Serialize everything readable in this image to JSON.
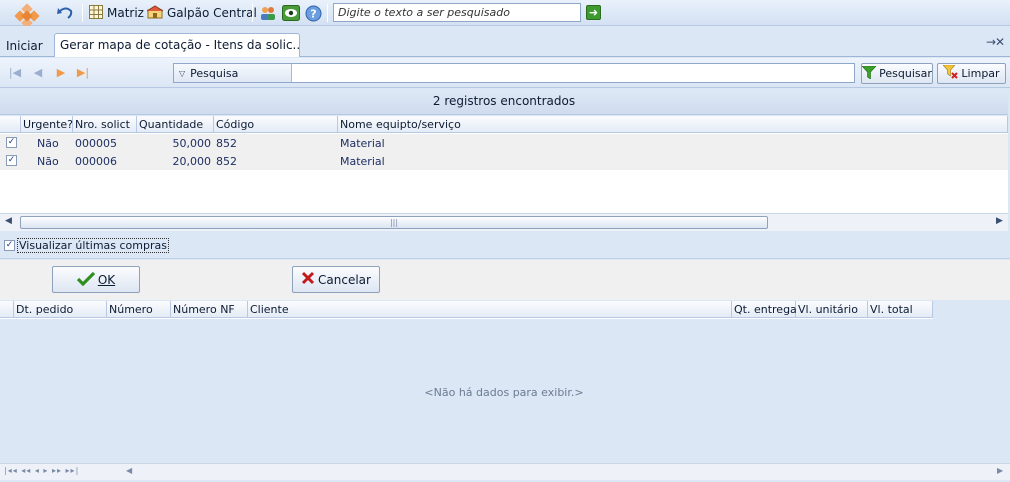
{
  "toolbar": {
    "items": [
      {
        "label": "Matriz",
        "icon": "grid-icon"
      },
      {
        "label": "Galpão Central",
        "icon": "warehouse-icon"
      }
    ],
    "search_placeholder": "Digite o texto a ser pesquisado"
  },
  "tabs": {
    "home": "Iniciar",
    "active": "Gerar mapa de cotação - Itens da solic..."
  },
  "filter": {
    "dropdown_label": "Pesquisa",
    "search_button": "Pesquisar",
    "clear_button": "Limpar"
  },
  "grid1": {
    "record_count": "2 registros encontrados",
    "headers": [
      "Urgente?",
      "Nro. solict",
      "Quantidade",
      "Código",
      "Nome equipto/serviço"
    ],
    "rows": [
      {
        "urgente": "Não",
        "nro": "000005",
        "quantidade": "50,000",
        "codigo": "852",
        "nome": "Material",
        "checked": true
      },
      {
        "urgente": "Não",
        "nro": "000006",
        "quantidade": "20,000",
        "codigo": "852",
        "nome": "Material",
        "checked": true
      }
    ]
  },
  "options": {
    "show_last_purchases": "Visualizar últimas compras",
    "show_last_purchases_checked": true
  },
  "actions": {
    "ok": "OK",
    "cancel": "Cancelar"
  },
  "grid2": {
    "headers": [
      "Dt. pedido",
      "Número",
      "Número NF",
      "Cliente",
      "Qt. entrega",
      "Vl. unitário",
      "Vl. total"
    ],
    "empty_message": "<Não há dados para exibir.>"
  },
  "colors": {
    "accent": "#dce7f5",
    "ok_green": "#2f8f1f",
    "cancel_red": "#c21a1a",
    "logo_orange": "#f19a4b"
  }
}
